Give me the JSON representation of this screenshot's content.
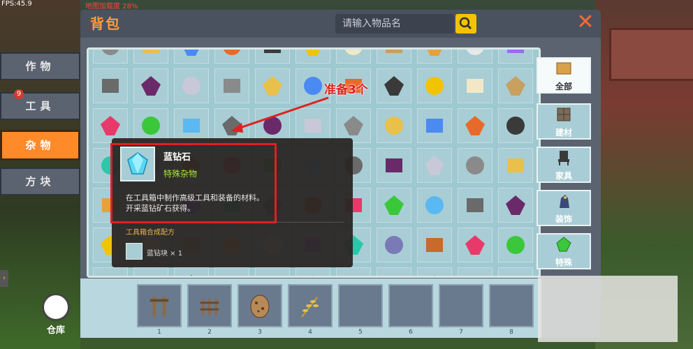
{
  "hud": {
    "fps": "FPS:45.9",
    "load": "地图加载度 28%"
  },
  "panel": {
    "title": "背包",
    "search_placeholder": "请输入物品名",
    "close": "✕"
  },
  "left_tabs": [
    {
      "label": "作物",
      "active": false
    },
    {
      "label": "工具",
      "active": false,
      "badge": "9"
    },
    {
      "label": "杂物",
      "active": true
    },
    {
      "label": "方块",
      "active": false
    }
  ],
  "right_tabs": [
    {
      "label": "全部",
      "selected": true
    },
    {
      "label": "建材",
      "selected": false
    },
    {
      "label": "家具",
      "selected": false
    },
    {
      "label": "装饰",
      "selected": false
    },
    {
      "label": "特殊",
      "selected": false
    }
  ],
  "annotation": "准备3个",
  "tooltip": {
    "name": "蓝钻石",
    "type": "特殊杂物",
    "desc1": "在工具箱中制作高级工具和装备的材料。",
    "desc2": "开采蓝钻矿石获得。",
    "recipe_label": "工具箱合成配方",
    "recipe_item": "蓝钻块 × 1"
  },
  "hotbar": {
    "slots": [
      {
        "num": "1",
        "icon": "wooden-gate-icon"
      },
      {
        "num": "2",
        "icon": "wooden-fence-icon"
      },
      {
        "num": "3",
        "icon": "spotted-egg-icon"
      },
      {
        "num": "4",
        "icon": "wheat-icon"
      },
      {
        "num": "5",
        "icon": ""
      },
      {
        "num": "6",
        "icon": ""
      },
      {
        "num": "7",
        "icon": ""
      },
      {
        "num": "8",
        "icon": ""
      }
    ]
  },
  "warehouse": {
    "label": "仓库"
  },
  "colors": {
    "accent": "#ff8a2a",
    "title": "#ff9b3a",
    "search_btn": "#f2c300",
    "highlight_red": "#e02020",
    "type_green": "#a8e63a"
  }
}
